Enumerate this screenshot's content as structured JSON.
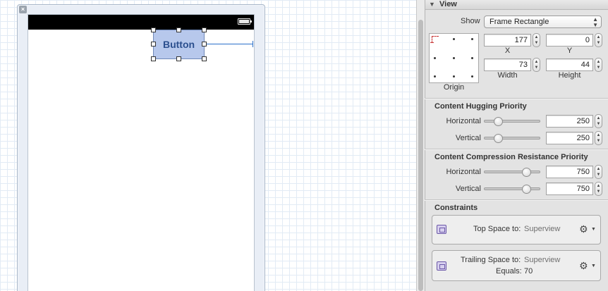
{
  "canvas": {
    "button_title": "Button"
  },
  "inspector": {
    "section_title": "View",
    "show_label": "Show",
    "show_value": "Frame Rectangle",
    "frame": {
      "x_label": "X",
      "x_value": "177",
      "y_label": "Y",
      "y_value": "0",
      "width_label": "Width",
      "width_value": "73",
      "height_label": "Height",
      "height_value": "44",
      "origin_label": "Origin"
    },
    "hugging": {
      "title": "Content Hugging Priority",
      "horizontal_label": "Horizontal",
      "horizontal_value": "250",
      "horizontal_level": 250,
      "vertical_label": "Vertical",
      "vertical_value": "250",
      "vertical_level": 250
    },
    "compression": {
      "title": "Content Compression Resistance Priority",
      "horizontal_label": "Horizontal",
      "horizontal_value": "750",
      "horizontal_level": 750,
      "vertical_label": "Vertical",
      "vertical_value": "750",
      "vertical_level": 750
    },
    "constraints": {
      "title": "Constraints",
      "items": [
        {
          "label": "Top Space to:",
          "target": "Superview"
        },
        {
          "label": "Trailing Space to:",
          "target": "Superview",
          "equals_label": "Equals:",
          "equals_value": "70"
        }
      ]
    }
  },
  "colors": {
    "button_fill": "#b7c8ec",
    "constraint_line": "#2a6fc9",
    "constraint_icon": "#6b57a8"
  }
}
